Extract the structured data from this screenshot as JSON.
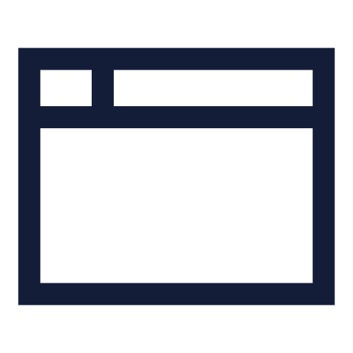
{
  "icon": {
    "name": "browser-window-icon",
    "stroke_color": "#141d38",
    "background_color": "#ffffff"
  }
}
